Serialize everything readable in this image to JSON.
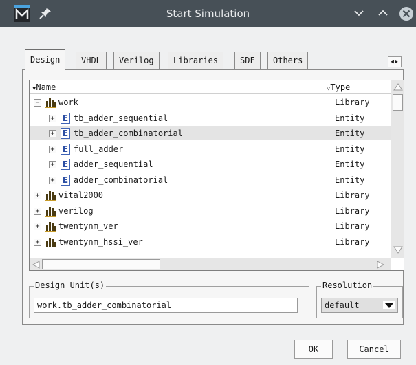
{
  "window": {
    "title": "Start Simulation",
    "app_icon_letter": "M"
  },
  "tabs": [
    {
      "label": "Design"
    },
    {
      "label": "VHDL"
    },
    {
      "label": "Verilog"
    },
    {
      "label": "Libraries"
    },
    {
      "label": "SDF"
    },
    {
      "label": "Others"
    }
  ],
  "tree": {
    "columns": {
      "name": "Name",
      "type": "Type"
    },
    "rows": [
      {
        "name": "work",
        "type": "Library",
        "expander": "−",
        "kind": "library"
      },
      {
        "name": "tb_adder_sequential",
        "type": "Entity",
        "expander": "+",
        "kind": "entity"
      },
      {
        "name": "tb_adder_combinatorial",
        "type": "Entity",
        "expander": "+",
        "kind": "entity",
        "selected": true
      },
      {
        "name": "full_adder",
        "type": "Entity",
        "expander": "+",
        "kind": "entity"
      },
      {
        "name": "adder_sequential",
        "type": "Entity",
        "expander": "+",
        "kind": "entity"
      },
      {
        "name": "adder_combinatorial",
        "type": "Entity",
        "expander": "+",
        "kind": "entity"
      },
      {
        "name": "vital2000",
        "type": "Library",
        "expander": "+",
        "kind": "library"
      },
      {
        "name": "verilog",
        "type": "Library",
        "expander": "+",
        "kind": "library"
      },
      {
        "name": "twentynm_ver",
        "type": "Library",
        "expander": "+",
        "kind": "library"
      },
      {
        "name": "twentynm_hssi_ver",
        "type": "Library",
        "expander": "+",
        "kind": "library"
      }
    ],
    "entity_icon_letter": "E"
  },
  "design_unit": {
    "legend": "Design Unit(s)",
    "value": "work.tb_adder_combinatorial"
  },
  "resolution": {
    "legend": "Resolution",
    "value": "default"
  },
  "buttons": {
    "ok": "OK",
    "cancel": "Cancel"
  },
  "colors": {
    "titlebar": "#475057",
    "selection": "#e4e4e4",
    "library_icon": "#4a3b12",
    "entity_icon": "#2b4ea3",
    "close_button": "#c8d0d6"
  }
}
